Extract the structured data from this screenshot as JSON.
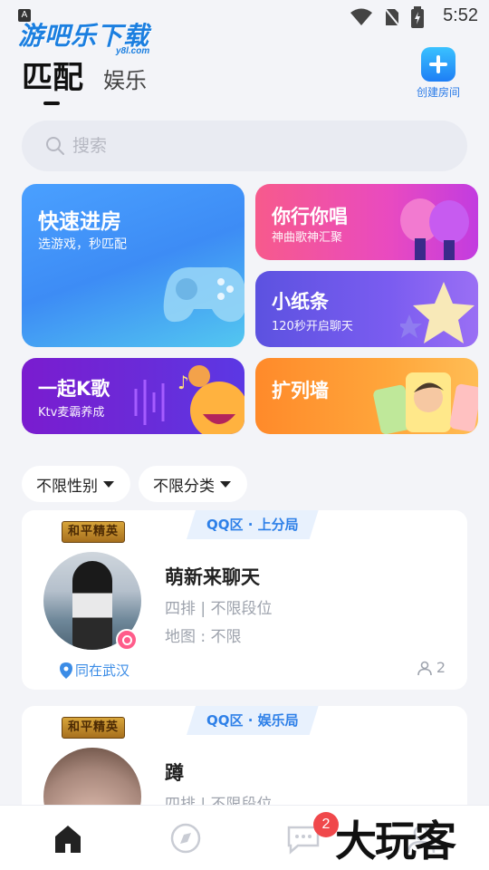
{
  "status_bar": {
    "time": "5:52",
    "a_badge": "A"
  },
  "watermark_top": {
    "text": "游吧乐下载",
    "sub": "y8l.com"
  },
  "header": {
    "tab_active": "匹配",
    "tab_other": "娱乐",
    "create_room_label": "创建房间"
  },
  "search": {
    "placeholder": "搜索"
  },
  "cards": {
    "quick": {
      "title": "快速进房",
      "subtitle": "选游戏，秒匹配"
    },
    "sing": {
      "title": "你行你唱",
      "subtitle": "神曲歌神汇聚"
    },
    "note": {
      "title": "小纸条",
      "subtitle": "120秒开启聊天"
    },
    "ktv": {
      "title": "一起K歌",
      "subtitle": "Ktv麦霸养成"
    },
    "wall": {
      "title": "扩列墙"
    }
  },
  "filters": {
    "gender": "不限性别",
    "category": "不限分类"
  },
  "rooms": [
    {
      "game": "和平精英",
      "zone": "QQ区 · 上分局",
      "title": "萌新来聊天",
      "line1": "四排 | 不限段位",
      "line2": "地图 : 不限",
      "location": "同在武汉",
      "count": "2"
    },
    {
      "game": "和平精英",
      "zone": "QQ区 · 娱乐局",
      "title": "蹲",
      "line1": "四排 | 不限段位"
    }
  ],
  "bottom_nav": {
    "badge": "2"
  },
  "watermark_bottom": {
    "text": "大玩客"
  },
  "colors": {
    "accent": "#2e80e8",
    "badge": "#f0484b"
  }
}
